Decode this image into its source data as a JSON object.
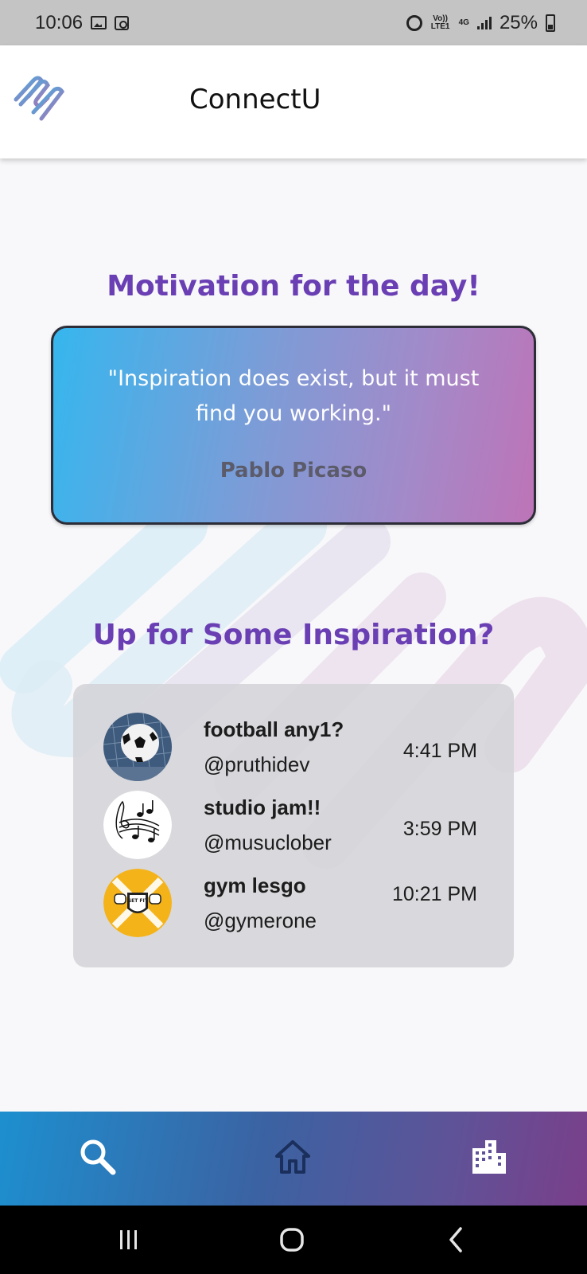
{
  "status_bar": {
    "time": "10:06",
    "network_volte": "Vo)) LTE1",
    "network_type": "4G",
    "battery": "25%"
  },
  "app_bar": {
    "title": "ConnectU"
  },
  "motivation": {
    "heading": "Motivation for the day!",
    "quote": "\"Inspiration does exist, but it must find you working.\"",
    "author": "Pablo Picaso"
  },
  "inspiration": {
    "heading": "Up for Some Inspiration?",
    "items": [
      {
        "title": "football any1?",
        "handle": "@pruthidev",
        "time": "4:41 PM",
        "avatar_icon": "soccer-ball-icon"
      },
      {
        "title": "studio jam!!",
        "handle": "@musuclober",
        "time": "3:59 PM",
        "avatar_icon": "music-notes-icon"
      },
      {
        "title": "gym lesgo",
        "handle": "@gymerone",
        "time": "10:21 PM",
        "avatar_icon": "get-fit-gym-icon"
      }
    ]
  },
  "gym_badge_text": "GET FIT",
  "bottom_nav": {
    "items": [
      {
        "icon": "search-icon"
      },
      {
        "icon": "home-icon"
      },
      {
        "icon": "city-icon"
      }
    ]
  },
  "colors": {
    "heading": "#6a3fb4",
    "quote_gradient_start": "#36b6ee",
    "quote_gradient_end": "#bd74b7",
    "nav_gradient_start": "#1d8fcf",
    "nav_gradient_end": "#7a3f8a"
  }
}
